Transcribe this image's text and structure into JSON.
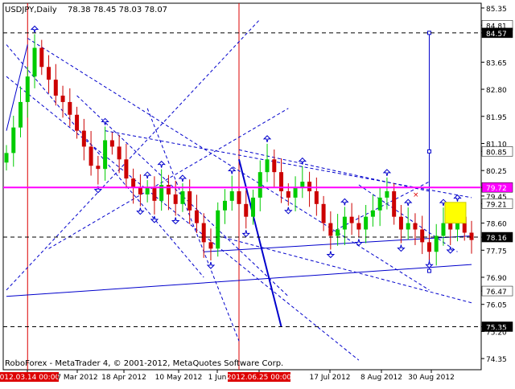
{
  "header": {
    "symbol": "USDJPY,Daily",
    "ohlc": "78.38 78.45 78.03 78.07"
  },
  "footer": {
    "copyright": "RoboForex - MetaTrader 4, © 2001-2012, MetaQuotes Software Corp."
  },
  "colors": {
    "background": "#ffffff",
    "up_candle": "#00cc00",
    "down_candle": "#cc0000",
    "resistance_line": "#ff00ff",
    "trend_lines": "#0000cc",
    "vertical_markers": "#dd0000",
    "target_box": "#ffff00",
    "price_marker": "#ffffff"
  },
  "chart_data": {
    "type": "candlestick",
    "symbol": "USDJPY",
    "timeframe": "Daily",
    "ylim": [
      74.0,
      85.5
    ],
    "y_ticks": [
      "85.35",
      "84.81",
      "84.57",
      "83.65",
      "82.80",
      "81.95",
      "81.10",
      "80.85",
      "80.25",
      "79.72",
      "79.45",
      "79.21",
      "78.60",
      "78.16",
      "77.75",
      "76.90",
      "76.47",
      "76.05",
      "75.35",
      "75.20",
      "74.35"
    ],
    "highlighted_levels": {
      "84.81": "plain",
      "84.57": "dark",
      "80.85": "plain",
      "79.72": "magenta",
      "79.21": "plain",
      "78.16": "dark",
      "76.47": "plain",
      "75.35": "dark"
    },
    "x_labels": [
      {
        "label": "2012.03.14 00:00",
        "highlight": true
      },
      {
        "label": "7 Mar 2012",
        "highlight": false
      },
      {
        "label": "18 Apr 2012",
        "highlight": false
      },
      {
        "label": "10 May 2012",
        "highlight": false
      },
      {
        "label": "1 Jun",
        "highlight": false
      },
      {
        "label": "2012.06.25 00:00",
        "highlight": true
      },
      {
        "label": "17 Jul 2012",
        "highlight": false
      },
      {
        "label": "8 Aug 2012",
        "highlight": false
      },
      {
        "label": "30 Aug 2012",
        "highlight": false
      }
    ],
    "close_path": [
      80.8,
      81.6,
      82.4,
      83.2,
      84.1,
      83.5,
      83.1,
      82.6,
      82.4,
      82.0,
      81.5,
      81.0,
      80.4,
      80.3,
      81.2,
      81.0,
      80.6,
      80.0,
      79.7,
      79.5,
      79.7,
      79.3,
      79.8,
      79.5,
      79.2,
      79.6,
      79.0,
      78.6,
      78.0,
      77.8,
      79.0,
      79.3,
      79.6,
      79.2,
      78.8,
      79.4,
      80.2,
      80.6,
      80.2,
      79.6,
      79.4,
      79.7,
      79.9,
      79.6,
      79.2,
      78.6,
      78.2,
      78.4,
      78.8,
      78.6,
      78.4,
      78.8,
      79.0,
      79.4,
      79.6,
      78.8,
      78.4,
      78.6,
      78.4,
      78.0,
      77.7,
      78.2,
      78.6,
      78.4,
      78.8,
      78.3,
      78.07
    ],
    "vertical_markers": [
      "2012.03.14 00:00",
      "2012.06.25 00:00"
    ],
    "horizontal_levels": [
      84.57,
      79.72,
      78.16,
      75.35
    ]
  }
}
